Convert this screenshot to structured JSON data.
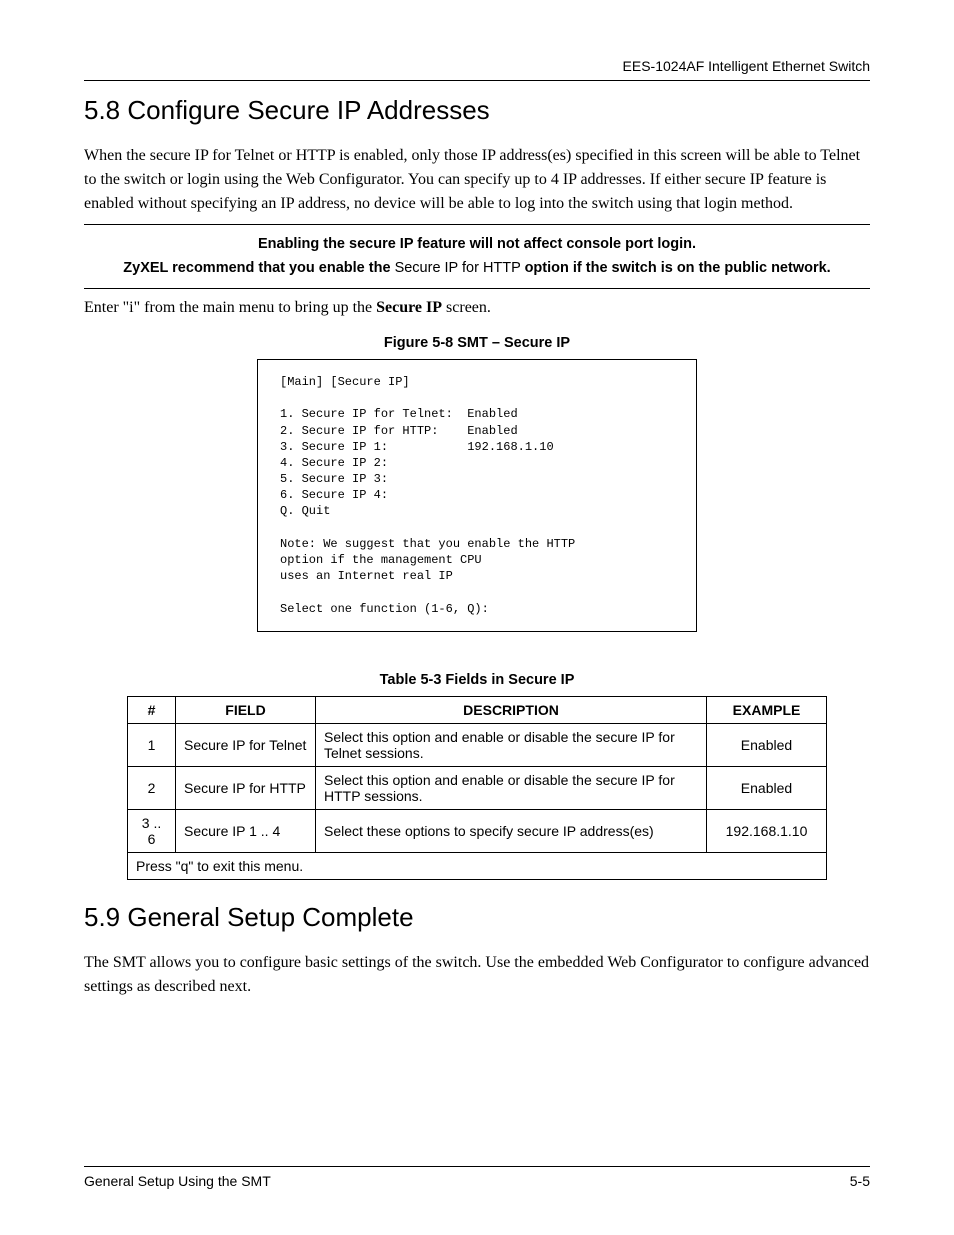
{
  "header": {
    "product": "EES-1024AF Intelligent Ethernet Switch"
  },
  "section58": {
    "title": "5.8 Configure Secure IP Addresses",
    "para": "When the secure IP for Telnet or HTTP is enabled, only those IP address(es) specified in this screen will be able to Telnet to the switch or login using the Web Configurator. You can specify up to 4 IP addresses. If either secure IP feature is enabled without specifying an IP address, no device will be able to log into the switch using that login method.",
    "note1": "Enabling the secure IP feature will not affect console port login.",
    "note2_pre_bold": "ZyXEL recommend that you enable the ",
    "note2_mid": "Secure IP for HTTP ",
    "note2_post_bold": "option if the switch is on the public network.",
    "enter_pre": "Enter \"i\" from the main menu to bring up the ",
    "enter_bold": "Secure IP",
    "enter_post": " screen."
  },
  "figure": {
    "caption": "Figure 5-8 SMT – Secure IP",
    "content": "[Main] [Secure IP]\n\n1. Secure IP for Telnet:  Enabled\n2. Secure IP for HTTP:    Enabled\n3. Secure IP 1:           192.168.1.10\n4. Secure IP 2:\n5. Secure IP 3:\n6. Secure IP 4:\nQ. Quit\n\nNote: We suggest that you enable the HTTP\noption if the management CPU\nuses an Internet real IP\n\nSelect one function (1-6, Q):"
  },
  "table": {
    "caption": "Table 5-3 Fields in Secure IP",
    "headers": {
      "num": "#",
      "field": "FIELD",
      "desc": "DESCRIPTION",
      "ex": "EXAMPLE"
    },
    "rows": [
      {
        "num": "1",
        "field": "Secure IP for Telnet",
        "desc": "Select this option and enable or disable the secure IP for Telnet sessions.",
        "ex": "Enabled"
      },
      {
        "num": "2",
        "field": "Secure IP for HTTP",
        "desc": "Select this option and enable or disable the secure IP for HTTP sessions.",
        "ex": "Enabled"
      },
      {
        "num": "3 .. 6",
        "field": "Secure IP 1 .. 4",
        "desc": "Select these options to specify secure IP address(es)",
        "ex": "192.168.1.10"
      }
    ],
    "footer_text": "Press \"q\" to exit this menu."
  },
  "section59": {
    "title": "5.9 General Setup Complete",
    "para": "The SMT allows you to configure basic settings of the switch. Use the embedded Web Configurator to configure advanced settings as described next."
  },
  "footer": {
    "left": "General Setup Using the SMT",
    "right": "5-5"
  }
}
